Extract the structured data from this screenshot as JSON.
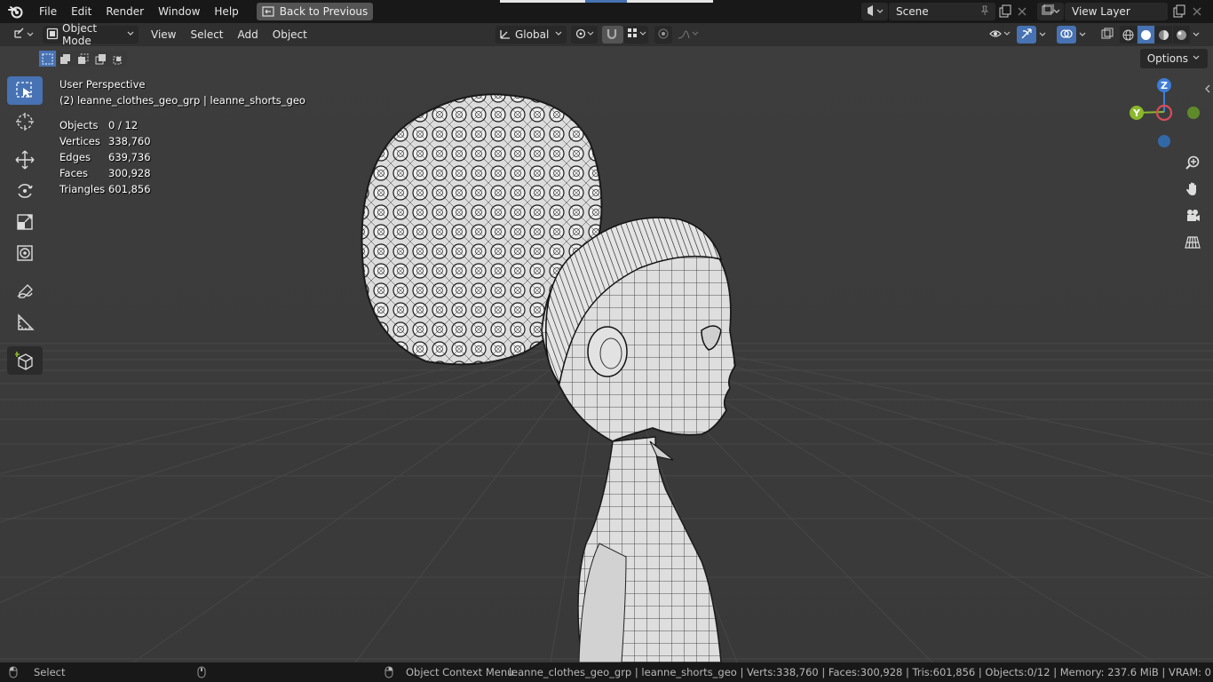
{
  "menubar": {
    "items": [
      "File",
      "Edit",
      "Render",
      "Window",
      "Help"
    ],
    "back_button": "Back to Previous",
    "scene": "Scene",
    "view_layer": "View Layer"
  },
  "header": {
    "mode": "Object Mode",
    "menus": [
      "View",
      "Select",
      "Add",
      "Object"
    ],
    "transform_orientation": "Global",
    "options": "Options"
  },
  "overlay": {
    "view_name": "User Perspective",
    "collection": "(2) leanne_clothes_geo_grp | leanne_shorts_geo",
    "stats": [
      {
        "label": "Objects",
        "value": "0 / 12"
      },
      {
        "label": "Vertices",
        "value": "338,760"
      },
      {
        "label": "Edges",
        "value": "639,736"
      },
      {
        "label": "Faces",
        "value": "300,928"
      },
      {
        "label": "Triangles",
        "value": "601,856"
      }
    ]
  },
  "gizmo": {
    "z": "Z",
    "y": "Y"
  },
  "statusbar": {
    "select": "Select",
    "context_menu": "Object Context Menu",
    "info": "leanne_clothes_geo_grp | leanne_shorts_geo | Verts:338,760 | Faces:300,928 | Tris:601,856 | Objects:0/12 | Memory: 237.6 MiB | VRAM: 0"
  },
  "colors": {
    "accent": "#4772b3",
    "axis_x": "#d94c5a",
    "axis_y": "#8ab82a",
    "axis_z": "#3d7dd6"
  }
}
